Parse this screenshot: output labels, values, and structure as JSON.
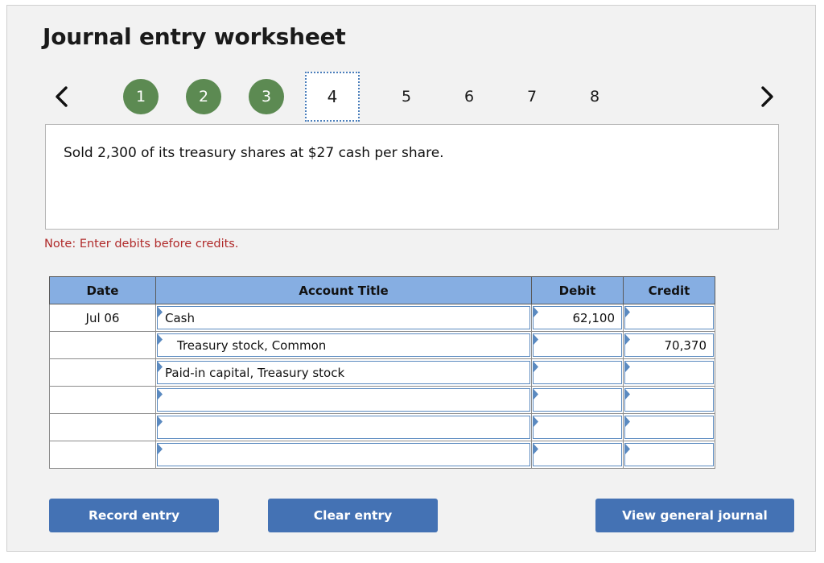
{
  "header": {
    "title": "Journal entry worksheet"
  },
  "pager": {
    "prev_icon": "chevron-left-icon",
    "next_icon": "chevron-right-icon",
    "items": [
      {
        "label": "1",
        "state": "done"
      },
      {
        "label": "2",
        "state": "done"
      },
      {
        "label": "3",
        "state": "done"
      },
      {
        "label": "4",
        "state": "current"
      },
      {
        "label": "5",
        "state": "pending"
      },
      {
        "label": "6",
        "state": "pending"
      },
      {
        "label": "7",
        "state": "pending"
      },
      {
        "label": "8",
        "state": "pending"
      }
    ]
  },
  "description": {
    "text": "Sold 2,300 of its treasury shares at $27 cash per share."
  },
  "note": {
    "text": "Note: Enter debits before credits."
  },
  "table": {
    "columns": [
      "Date",
      "Account Title",
      "Debit",
      "Credit"
    ],
    "rows": [
      {
        "date": "Jul 06",
        "account": "Cash",
        "indent": false,
        "debit": "62,100",
        "credit": ""
      },
      {
        "date": "",
        "account": "Treasury stock, Common",
        "indent": true,
        "debit": "",
        "credit": "70,370"
      },
      {
        "date": "",
        "account": "Paid-in capital, Treasury stock",
        "indent": false,
        "debit": "",
        "credit": ""
      },
      {
        "date": "",
        "account": "",
        "indent": false,
        "debit": "",
        "credit": ""
      },
      {
        "date": "",
        "account": "",
        "indent": false,
        "debit": "",
        "credit": ""
      },
      {
        "date": "",
        "account": "",
        "indent": false,
        "debit": "",
        "credit": ""
      }
    ]
  },
  "buttons": {
    "record": "Record entry",
    "clear": "Clear entry",
    "view": "View general journal"
  },
  "colors": {
    "header_blue": "#86aee2",
    "button_blue": "#4472b4",
    "step_green": "#5c8a52",
    "note_red": "#b02a2a",
    "cell_border_blue": "#5b8ac0",
    "panel_bg": "#f2f2f2"
  }
}
